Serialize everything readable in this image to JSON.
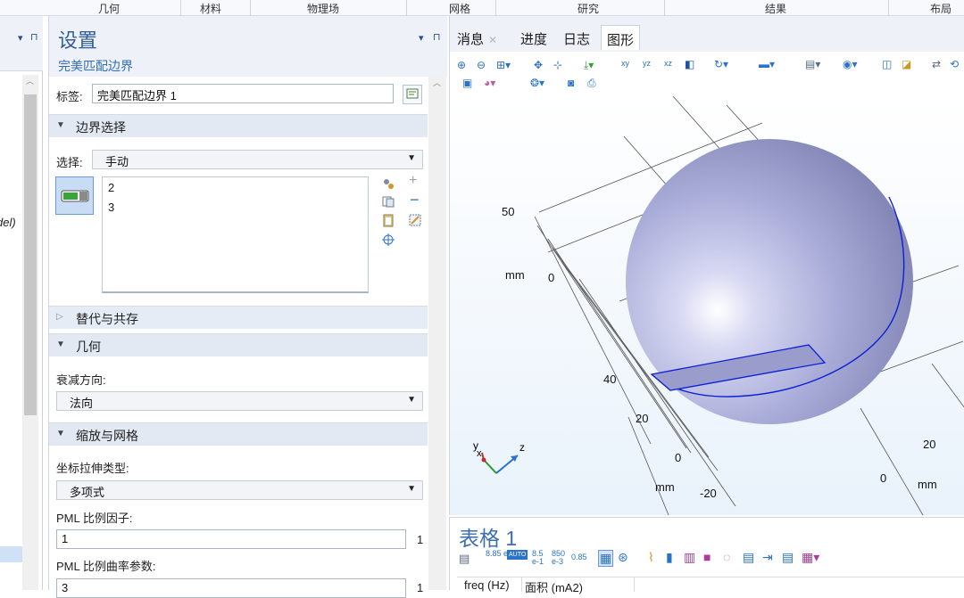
{
  "ribbon": {
    "groups": [
      "几何",
      "材料",
      "物理场",
      "网格",
      "研究",
      "结果",
      "布局"
    ]
  },
  "left_pane": {
    "partial_text": "del)"
  },
  "settings": {
    "title": "设置",
    "subtitle": "完美匹配边界",
    "label_caption": "标签:",
    "label_value": "完美匹配边界 1",
    "sections": {
      "boundary_selection": "边界选择",
      "override": "替代与共存",
      "geometry": "几何",
      "scaling": "缩放与网格"
    },
    "selection_caption": "选择:",
    "selection_value": "手动",
    "selected_items": [
      "2",
      "3"
    ],
    "decay_caption": "衰减方向:",
    "decay_value": "法向",
    "stretch_caption": "坐标拉伸类型:",
    "stretch_value": "多项式",
    "pml_scale_caption": "PML 比例因子:",
    "pml_scale_value": "1",
    "pml_scale_unit": "1",
    "pml_curv_caption": "PML 比例曲率参数:",
    "pml_curv_value": "3",
    "pml_curv_unit": "1"
  },
  "graphics": {
    "tabs": [
      "消息",
      "进度",
      "日志",
      "图形"
    ],
    "active_tab": "图形",
    "axis_labels": {
      "y_50": "50",
      "mm_left": "mm",
      "zero_left": "0",
      "forty": "40",
      "twenty_left": "20",
      "zero_bottom": "0",
      "mm_bottom": "mm",
      "neg20": "-20",
      "twenty_right": "20",
      "zero_right": "0",
      "mm_right": "mm"
    },
    "triad": {
      "y": "y",
      "x": "x",
      "z": "z"
    },
    "colors": {
      "sphere": "#a9acd8",
      "edge": "#0a1fd6",
      "background_bottom": "#e9f2fb"
    }
  },
  "table": {
    "title": "表格 1",
    "num_formats": [
      "8.85 e-12",
      "AUTO",
      "8.5 e-1",
      "850 e-3",
      "0.85"
    ],
    "columns": [
      "freq (Hz)",
      "面积 (mA2)"
    ]
  }
}
